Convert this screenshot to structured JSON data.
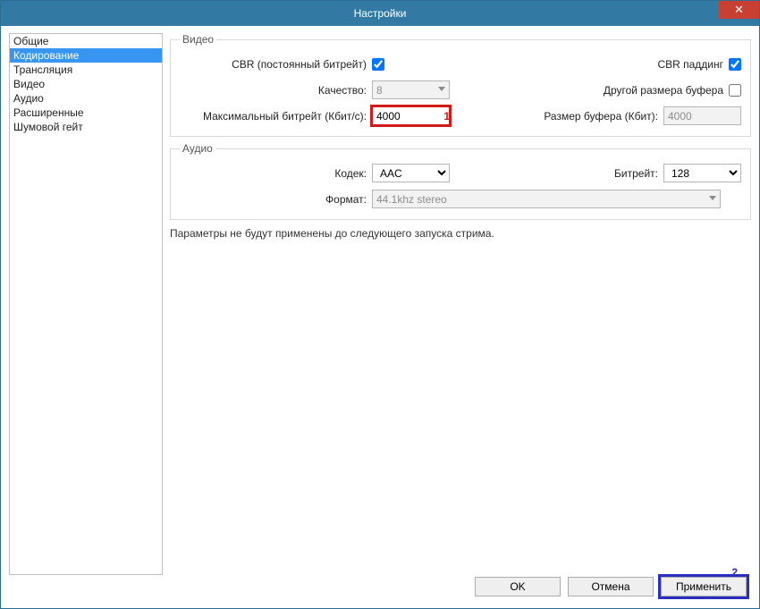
{
  "window": {
    "title": "Настройки",
    "close_glyph": "✕"
  },
  "sidebar": {
    "items": [
      "Общие",
      "Кодирование",
      "Трансляция",
      "Видео",
      "Аудио",
      "Расширенные",
      "Шумовой гейт"
    ],
    "selected_index": 1
  },
  "video_group": {
    "legend": "Видео",
    "cbr_label": "CBR (постоянный битрейт)",
    "cbr_checked": true,
    "cbr_padding_label": "CBR паддинг",
    "cbr_padding_checked": true,
    "quality_label": "Качество:",
    "quality_value": "8",
    "buffer_other_label": "Другой размера буфера",
    "buffer_other_checked": false,
    "max_bitrate_label": "Максимальный битрейт (Кбит/с):",
    "max_bitrate_value": "4000",
    "buffer_size_label": "Размер буфера (Кбит):",
    "buffer_size_value": "4000"
  },
  "audio_group": {
    "legend": "Аудио",
    "codec_label": "Кодек:",
    "codec_value": "AAC",
    "bitrate_label": "Битрейт:",
    "bitrate_value": "128",
    "format_label": "Формат:",
    "format_value": "44.1khz stereo"
  },
  "note": "Параметры не будут применены до следующего запуска стрима.",
  "buttons": {
    "ok": "OK",
    "cancel": "Отмена",
    "apply": "Применить"
  },
  "annotations": {
    "one": "1",
    "two": "2"
  }
}
